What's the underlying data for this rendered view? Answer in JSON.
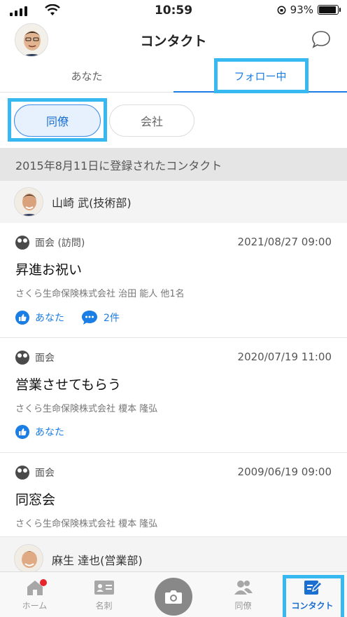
{
  "status_bar": {
    "time": "10:59",
    "battery": "93%",
    "battery_level": 0.93
  },
  "header": {
    "title": "コンタクト"
  },
  "tabs": [
    {
      "label": "あなた"
    },
    {
      "label": "フォロー中"
    }
  ],
  "segments": [
    {
      "label": "同僚"
    },
    {
      "label": "会社"
    }
  ],
  "section": {
    "date_label": "2015年8月11日に登録されたコンタクト"
  },
  "people": [
    {
      "name": "山崎 武(技術部)"
    },
    {
      "name": "麻生 達也(営業部)"
    }
  ],
  "contacts": [
    {
      "type": "面会 (訪問)",
      "datetime": "2021/08/27 09:00",
      "title": "昇進お祝い",
      "company": "さくら生命保険株式会社 治田 能人 他1名",
      "like_label": "あなた",
      "comment_label": "2件"
    },
    {
      "type": "面会",
      "datetime": "2020/07/19 11:00",
      "title": "営業させてもらう",
      "company": "さくら生命保険株式会社 榎本 隆弘",
      "like_label": "あなた"
    },
    {
      "type": "面会",
      "datetime": "2009/06/19 09:00",
      "title": "同窓会",
      "company": "さくら生命保険株式会社 榎本 隆弘"
    }
  ],
  "bottom_nav": [
    {
      "label": "ホーム",
      "icon": "home-icon"
    },
    {
      "label": "名刺",
      "icon": "business-card-icon"
    },
    {
      "label": "",
      "icon": "camera-icon"
    },
    {
      "label": "同僚",
      "icon": "colleagues-icon"
    },
    {
      "label": "コンタクト",
      "icon": "contact-edit-icon"
    }
  ],
  "colors": {
    "accent": "#1b7ee4",
    "highlight": "#37b8f0",
    "badge": "#e6242b"
  }
}
